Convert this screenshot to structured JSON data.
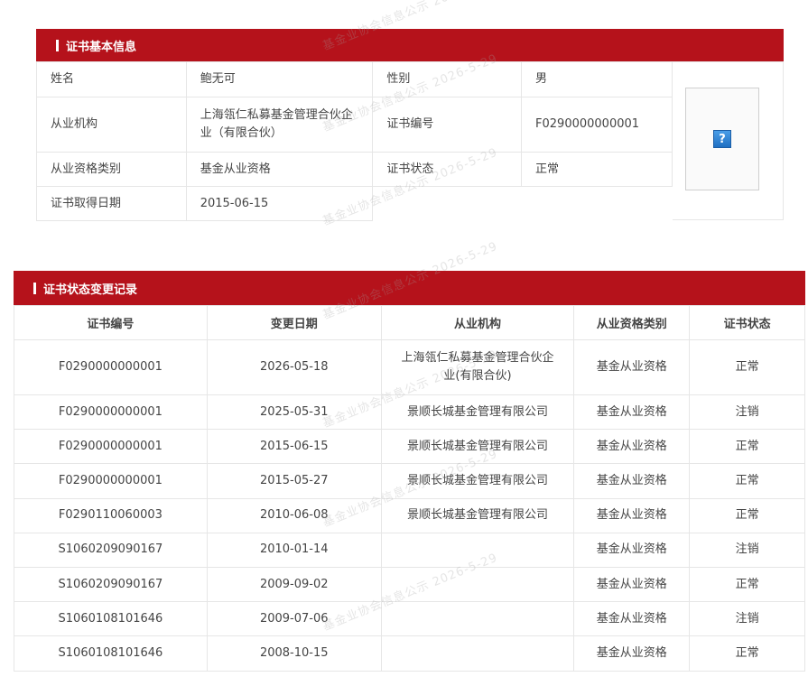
{
  "watermark": "基金业协会信息公示 2026-5-29",
  "basic_info": {
    "title": "证书基本信息",
    "name_label": "姓名",
    "name_value": "鲍无可",
    "gender_label": "性别",
    "gender_value": "男",
    "institution_label": "从业机构",
    "institution_value": "上海瓴仁私募基金管理合伙企业（有限合伙）",
    "cert_no_label": "证书编号",
    "cert_no_value": "F0290000000001",
    "qual_type_label": "从业资格类别",
    "qual_type_value": "基金从业资格",
    "cert_status_label": "证书状态",
    "cert_status_value": "正常",
    "cert_date_label": "证书取得日期",
    "cert_date_value": "2015-06-15",
    "photo_icon": "question-mark-icon",
    "photo_icon_glyph": "?"
  },
  "records": {
    "title": "证书状态变更记录",
    "headers": [
      "证书编号",
      "变更日期",
      "从业机构",
      "从业资格类别",
      "证书状态"
    ],
    "rows": [
      {
        "cert_no": "F0290000000001",
        "date": "2026-05-18",
        "institution": "上海瓴仁私募基金管理合伙企业(有限合伙)",
        "qual": "基金从业资格",
        "status": "正常"
      },
      {
        "cert_no": "F0290000000001",
        "date": "2025-05-31",
        "institution": "景顺长城基金管理有限公司",
        "qual": "基金从业资格",
        "status": "注销"
      },
      {
        "cert_no": "F0290000000001",
        "date": "2015-06-15",
        "institution": "景顺长城基金管理有限公司",
        "qual": "基金从业资格",
        "status": "正常"
      },
      {
        "cert_no": "F0290000000001",
        "date": "2015-05-27",
        "institution": "景顺长城基金管理有限公司",
        "qual": "基金从业资格",
        "status": "正常"
      },
      {
        "cert_no": "F0290110060003",
        "date": "2010-06-08",
        "institution": "景顺长城基金管理有限公司",
        "qual": "基金从业资格",
        "status": "正常"
      },
      {
        "cert_no": "S1060209090167",
        "date": "2010-01-14",
        "institution": "",
        "qual": "基金从业资格",
        "status": "注销"
      },
      {
        "cert_no": "S1060209090167",
        "date": "2009-09-02",
        "institution": "",
        "qual": "基金从业资格",
        "status": "正常"
      },
      {
        "cert_no": "S1060108101646",
        "date": "2009-07-06",
        "institution": "",
        "qual": "基金从业资格",
        "status": "注销"
      },
      {
        "cert_no": "S1060108101646",
        "date": "2008-10-15",
        "institution": "",
        "qual": "基金从业资格",
        "status": "正常"
      }
    ]
  },
  "colors": {
    "header_red": "#b5121b",
    "border": "#e6e6e6",
    "text": "#444444"
  }
}
